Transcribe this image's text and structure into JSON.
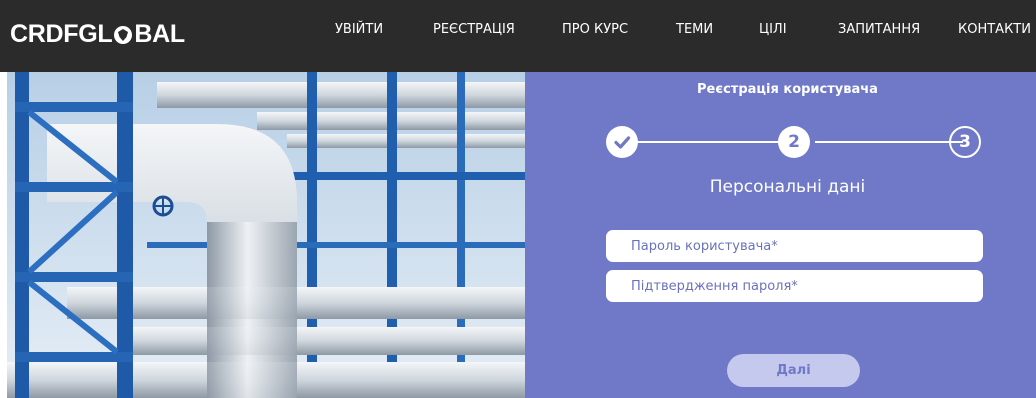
{
  "header": {
    "logo_before": "CRDFGL",
    "logo_after": "BAL",
    "nav": [
      {
        "label": "УВІЙТИ"
      },
      {
        "label": "РЕЄСТРАЦІЯ"
      },
      {
        "label": "ПРО КУРС"
      },
      {
        "label": "ТЕМИ"
      },
      {
        "label": "ЦІЛІ"
      },
      {
        "label": "ЗАПИТАННЯ"
      },
      {
        "label": "КОНТАКТИ"
      }
    ]
  },
  "registration": {
    "title": "Реєстрація користувача",
    "steps": [
      {
        "state": "done",
        "icon": "check-icon"
      },
      {
        "state": "current",
        "number": "2"
      },
      {
        "state": "upcoming",
        "number": "3"
      }
    ],
    "section_title": "Персональні дані",
    "password_placeholder": "Пароль користувача*",
    "confirm_placeholder": "Підтвердження пароля*",
    "next_label": "Далі"
  },
  "colors": {
    "topbar": "#2b2b2b",
    "panel": "#6f79c8",
    "button": "#c5c9ee"
  }
}
